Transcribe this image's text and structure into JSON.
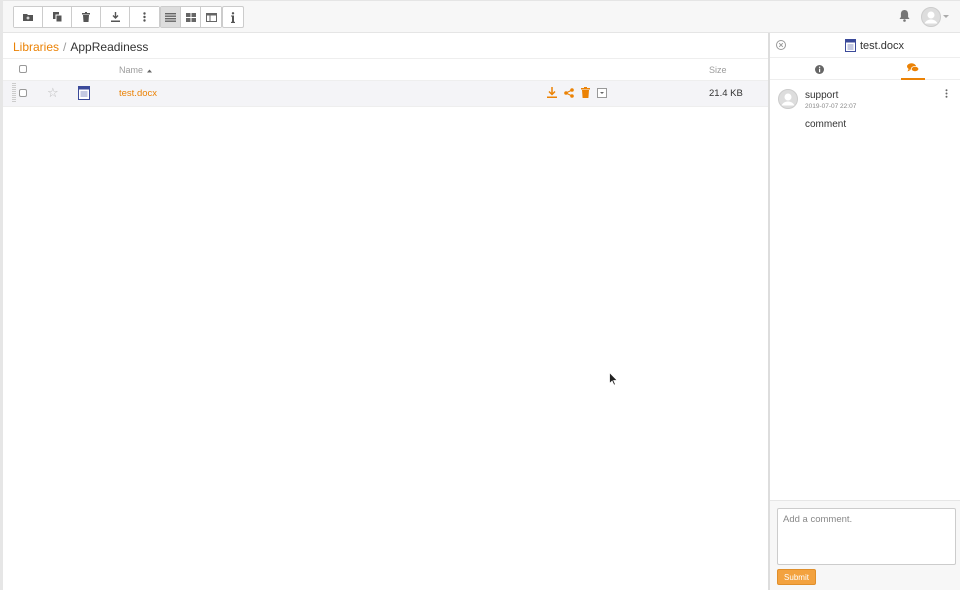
{
  "toolbar": {
    "buttons": [
      {
        "name": "new-folder-icon"
      },
      {
        "name": "copy-icon"
      },
      {
        "name": "trash-icon"
      },
      {
        "name": "download-icon"
      },
      {
        "name": "more-vertical-icon"
      }
    ],
    "views": [
      {
        "name": "list-view-icon",
        "active": true
      },
      {
        "name": "grid-view-icon",
        "active": false
      },
      {
        "name": "column-view-icon",
        "active": false
      }
    ],
    "info_icon": "info-icon"
  },
  "header": {
    "notification_icon": "bell-icon",
    "avatar_icon": "user-avatar-icon"
  },
  "breadcrumb": {
    "root": "Libraries",
    "separator": "/",
    "current": "AppReadiness"
  },
  "table": {
    "columns": {
      "name": "Name",
      "size": "Size"
    },
    "sort_icon": "sort-asc-icon",
    "rows": [
      {
        "name": "test.docx",
        "size": "21.4 KB",
        "starred": false
      }
    ]
  },
  "panel": {
    "title": "test.docx",
    "tabs": [
      {
        "name": "info-icon",
        "active": false
      },
      {
        "name": "comments-icon",
        "active": true
      }
    ],
    "comments": [
      {
        "author": "support",
        "time": "2019-07-07 22:07",
        "text": "comment"
      }
    ],
    "input_placeholder": "Add a comment.",
    "submit_label": "Submit"
  },
  "colors": {
    "accent": "#eb8205",
    "icon_gray": "#555555",
    "doc_blue": "#3b4a9a"
  }
}
